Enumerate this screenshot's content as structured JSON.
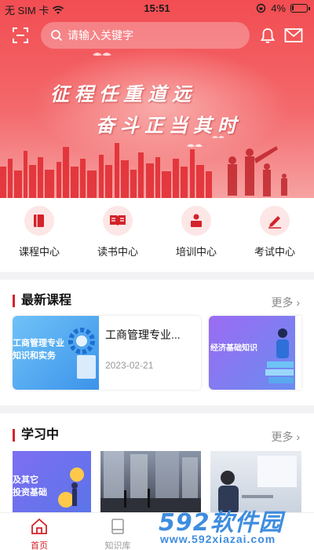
{
  "status_bar": {
    "carrier": "无 SIM 卡",
    "time": "15:51",
    "battery": "4%"
  },
  "search": {
    "placeholder": "请输入关键字"
  },
  "banner": {
    "slogan_line1": "征程任重道远",
    "slogan_line2": "奋斗正当其时"
  },
  "categories": [
    {
      "label": "课程中心",
      "icon": "book-icon"
    },
    {
      "label": "读书中心",
      "icon": "open-book-icon"
    },
    {
      "label": "培训中心",
      "icon": "trainer-icon"
    },
    {
      "label": "考试中心",
      "icon": "pencil-icon"
    }
  ],
  "latest_courses": {
    "title": "最新课程",
    "more": "更多",
    "items": [
      {
        "thumb_text_1": "工商管理专业",
        "thumb_text_2": "知识和实务",
        "name": "工商管理专业...",
        "date": "2023-02-21"
      },
      {
        "thumb_text_1": "经济基础知识"
      }
    ]
  },
  "studying": {
    "title": "学习中",
    "more": "更多",
    "items": [
      {
        "thumb_text_1": "及其它",
        "thumb_text_2": "投资基础"
      }
    ]
  },
  "bottom_nav": [
    {
      "label": "首页",
      "icon": "home-icon",
      "active": true
    },
    {
      "label": "知识库",
      "icon": "library-icon",
      "active": false
    }
  ],
  "watermark": {
    "big": "592软件园",
    "small": "www.592xiazai.com"
  },
  "colors": {
    "accent": "#d2232a",
    "banner": "#f24d52",
    "watermark": "#3f8ddf"
  }
}
